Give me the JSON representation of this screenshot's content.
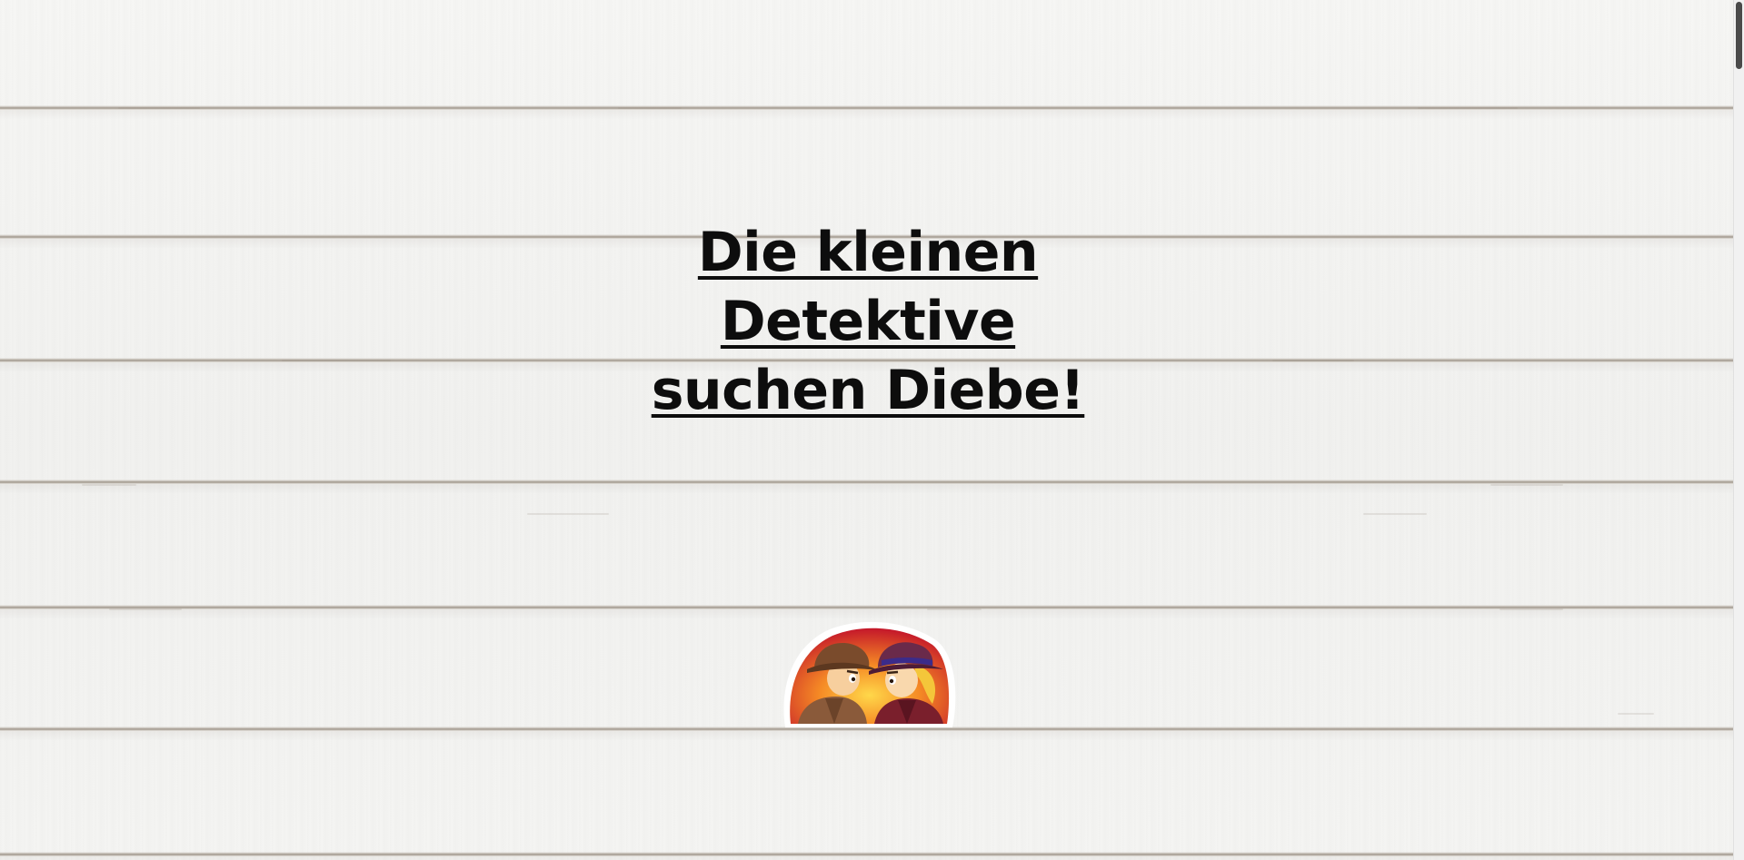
{
  "page": {
    "background": "white wooden planks",
    "accent_text_color": "#0d0d0d"
  },
  "hero": {
    "title_lines": [
      "Die kleinen",
      "Detektive",
      "suchen Diebe!"
    ]
  },
  "logo": {
    "icon": "two-detectives-logo"
  },
  "scrollbar": {
    "thumb_color": "#4a4a4a"
  }
}
